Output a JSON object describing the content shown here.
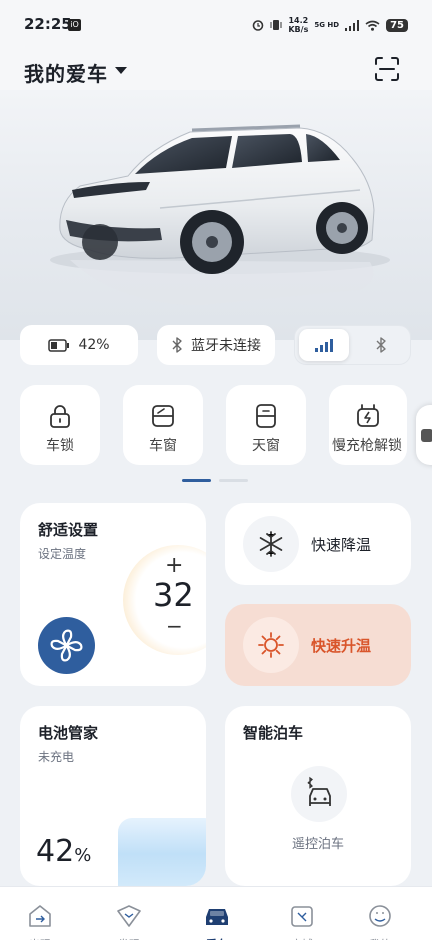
{
  "status_bar": {
    "time": "22:25",
    "speed": "14.2",
    "speed_unit": "KB/s",
    "network": "5G HD",
    "battery": "75"
  },
  "header": {
    "title": "我的爱车",
    "scan_icon": "scan-icon"
  },
  "vehicle_status": {
    "battery_percent": "42%",
    "bluetooth_status": "蓝牙未连接",
    "connection_modes": [
      "signal",
      "bluetooth"
    ],
    "active_mode": "signal"
  },
  "quick_controls": [
    {
      "label": "车锁",
      "icon": "lock-icon"
    },
    {
      "label": "车窗",
      "icon": "window-icon"
    },
    {
      "label": "天窗",
      "icon": "sunroof-icon"
    },
    {
      "label": "慢充枪解锁",
      "icon": "charger-unlock-icon"
    }
  ],
  "pager": {
    "pages": 2,
    "active": 0
  },
  "comfort": {
    "title": "舒适设置",
    "subtitle": "设定温度",
    "temperature": "32",
    "plus": "+",
    "minus": "−"
  },
  "quick_cool": {
    "label": "快速降温",
    "icon": "snowflake-icon"
  },
  "quick_heat": {
    "label": "快速升温",
    "icon": "sun-icon"
  },
  "battery_manager": {
    "title": "电池管家",
    "status": "未充电",
    "percent_value": "42",
    "percent_unit": "%"
  },
  "smart_parking": {
    "title": "智能泊车",
    "action_label": "遥控泊车"
  },
  "colors": {
    "accent_blue": "#2f5e9e",
    "heat_bg": "#f6ddd3",
    "heat_text": "#d9552b"
  },
  "tabbar": {
    "active": "tab-car",
    "tabs": [
      {
        "name": "tab-home",
        "label": "出现"
      },
      {
        "name": "tab-discover",
        "label": "发现"
      },
      {
        "name": "tab-car",
        "label": "爱车"
      },
      {
        "name": "tab-store",
        "label": "商城"
      },
      {
        "name": "tab-mine",
        "label": "我的"
      }
    ]
  }
}
